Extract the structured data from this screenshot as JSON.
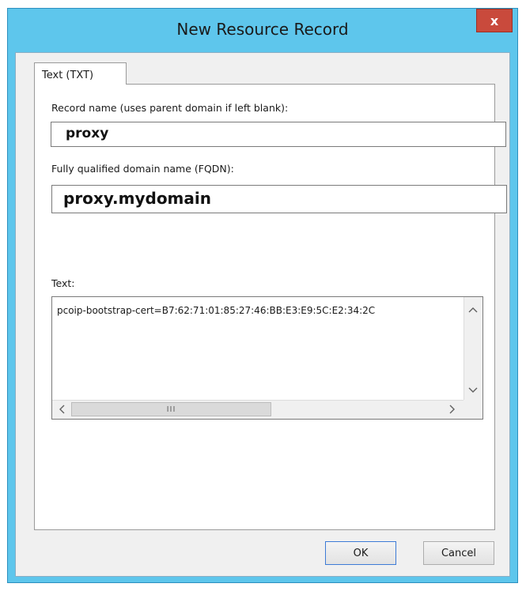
{
  "window": {
    "title": "New Resource Record",
    "close_label": "x"
  },
  "tab": {
    "label": "Text (TXT)"
  },
  "record_name": {
    "label": "Record name (uses parent domain if left blank):",
    "value": "proxy"
  },
  "fqdn": {
    "label": "Fully qualified domain name (FQDN):",
    "value": "proxy.mydomain"
  },
  "text": {
    "label": "Text:",
    "value": "pcoip-bootstrap-cert=B7:62:71:01:85:27:46:BB:E3:E9:5C:E2:34:2C"
  },
  "scrollbars": {
    "up_icon": "chevron-up-icon",
    "down_icon": "chevron-down-icon",
    "left_icon": "chevron-left-icon",
    "right_icon": "chevron-right-icon",
    "thumb_grip": "III"
  },
  "buttons": {
    "ok": "OK",
    "cancel": "Cancel"
  },
  "colors": {
    "titlebar": "#5ec6ec",
    "close": "#c94a3c",
    "dialog_bg": "#f0f0f0"
  }
}
